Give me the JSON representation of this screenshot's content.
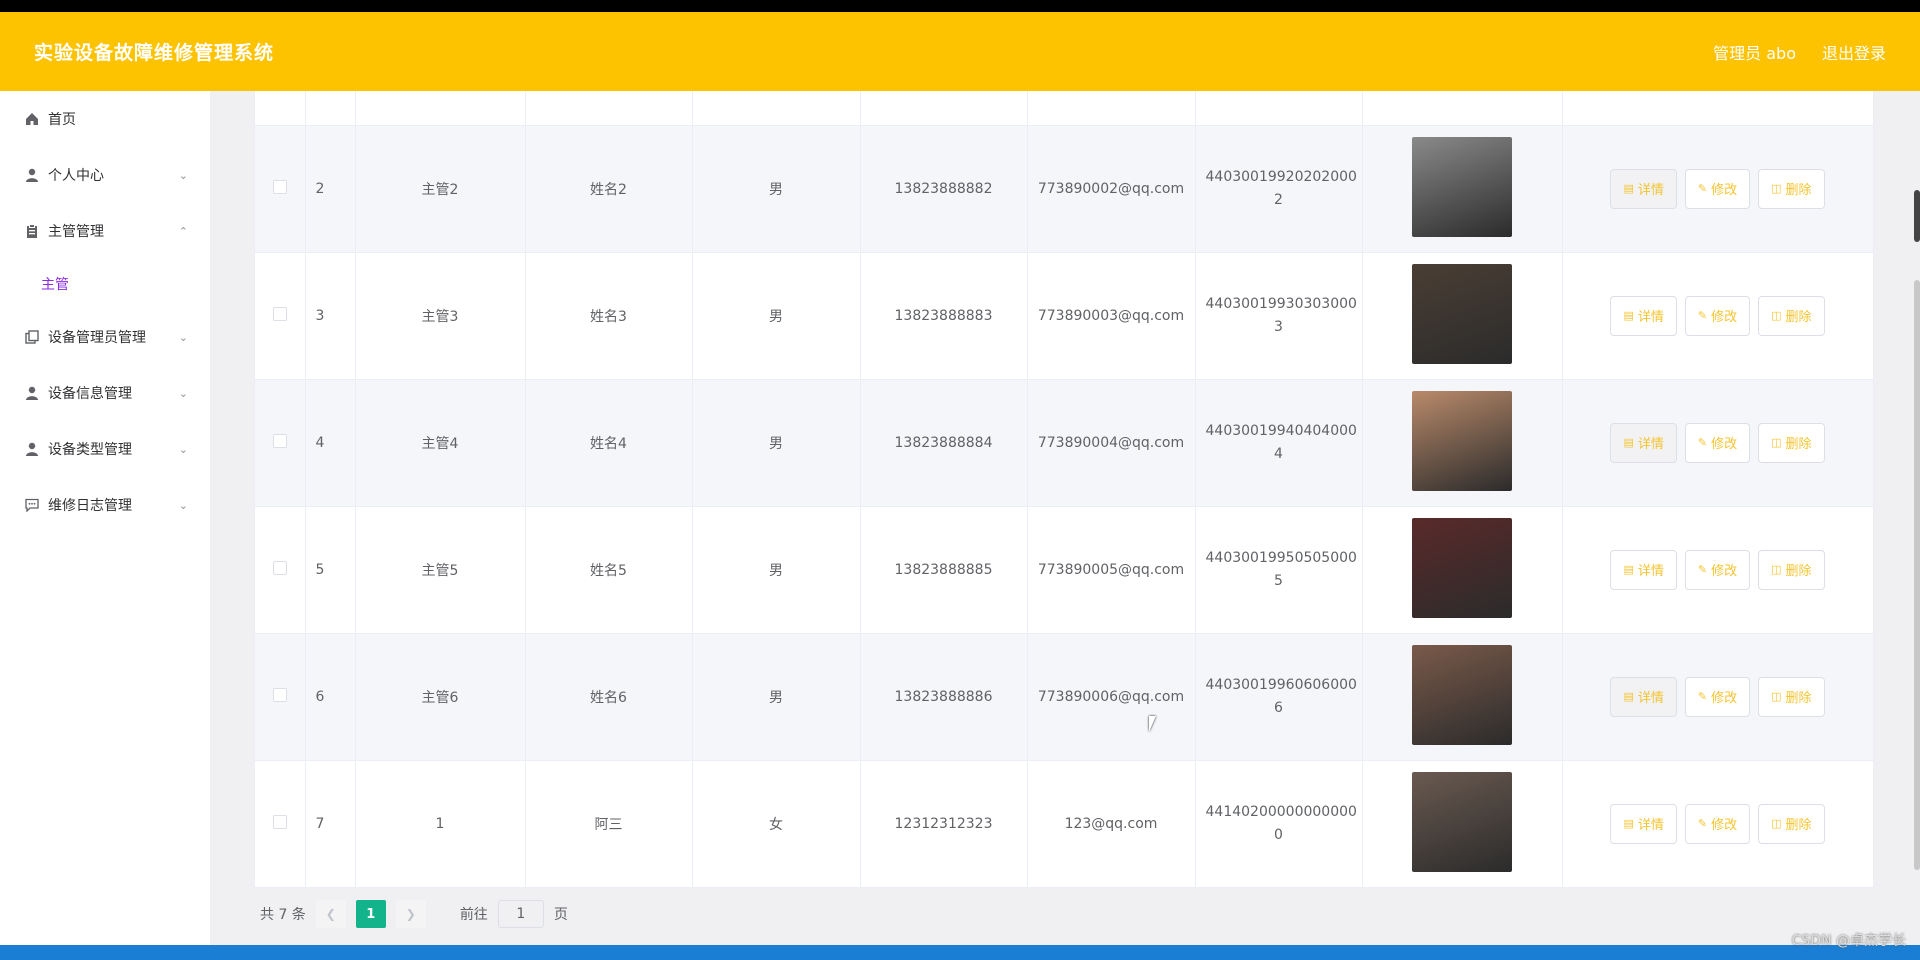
{
  "header": {
    "title": "实验设备故障维修管理系统",
    "admin_label": "管理员 abo",
    "logout_label": "退出登录"
  },
  "sidebar": {
    "items": [
      {
        "label": "首页",
        "icon": "home-icon"
      },
      {
        "label": "个人中心",
        "icon": "user-icon"
      },
      {
        "label": "主管管理",
        "icon": "clipboard-icon",
        "expanded": true
      },
      {
        "label": "设备管理员管理",
        "icon": "copy-icon"
      },
      {
        "label": "设备信息管理",
        "icon": "user-icon"
      },
      {
        "label": "设备类型管理",
        "icon": "user-icon"
      },
      {
        "label": "维修日志管理",
        "icon": "chat-icon"
      }
    ],
    "subitem": "主管"
  },
  "table": {
    "rows": [
      {
        "index": "2",
        "account": "主管2",
        "name": "姓名2",
        "gender": "男",
        "phone": "13823888882",
        "email": "773890002@qq.com",
        "idcard_1": "44030019920202000",
        "idcard_2": "2",
        "avatar_color": "#8a8a8a"
      },
      {
        "index": "3",
        "account": "主管3",
        "name": "姓名3",
        "gender": "男",
        "phone": "13823888883",
        "email": "773890003@qq.com",
        "idcard_1": "44030019930303000",
        "idcard_2": "3",
        "avatar_color": "#4a3e34"
      },
      {
        "index": "4",
        "account": "主管4",
        "name": "姓名4",
        "gender": "男",
        "phone": "13823888884",
        "email": "773890004@qq.com",
        "idcard_1": "44030019940404000",
        "idcard_2": "4",
        "avatar_color": "#b98a6a"
      },
      {
        "index": "5",
        "account": "主管5",
        "name": "姓名5",
        "gender": "男",
        "phone": "13823888885",
        "email": "773890005@qq.com",
        "idcard_1": "44030019950505000",
        "idcard_2": "5",
        "avatar_color": "#5a2a2a"
      },
      {
        "index": "6",
        "account": "主管6",
        "name": "姓名6",
        "gender": "男",
        "phone": "13823888886",
        "email": "773890006@qq.com",
        "idcard_1": "44030019960606000",
        "idcard_2": "6",
        "avatar_color": "#7a5a4a"
      },
      {
        "index": "7",
        "account": "1",
        "name": "阿三",
        "gender": "女",
        "phone": "12312312323",
        "email": "123@qq.com",
        "idcard_1": "44140200000000000",
        "idcard_2": "0",
        "avatar_color": "#6a5a50"
      }
    ],
    "btn_detail": "详情",
    "btn_edit": "修改",
    "btn_delete": "删除"
  },
  "pager": {
    "total": "共 7 条",
    "current": "1",
    "goto_prefix": "前往",
    "goto_value": "1",
    "goto_suffix": "页"
  },
  "watermark": "CSDN @卓杰学长"
}
